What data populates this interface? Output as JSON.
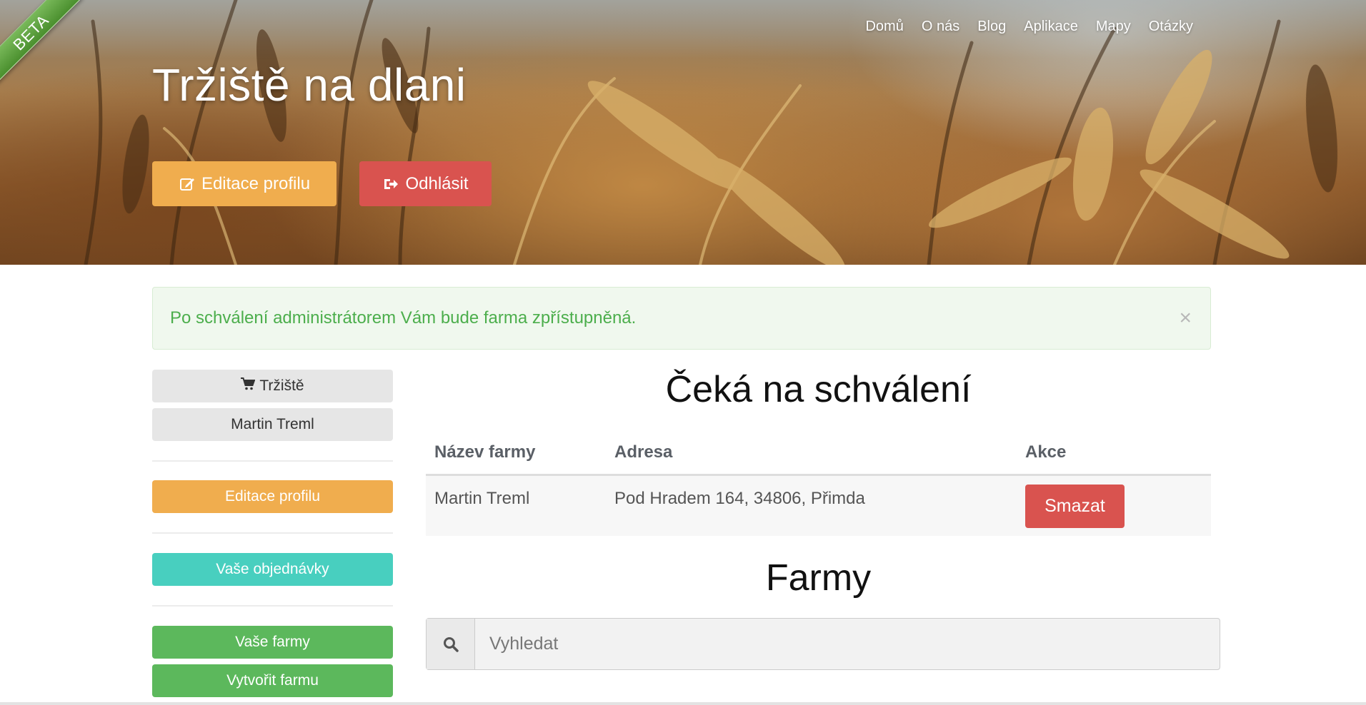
{
  "hero": {
    "beta": "BETA",
    "nav": [
      "Domů",
      "O nás",
      "Blog",
      "Aplikace",
      "Mapy",
      "Otázky"
    ],
    "title": "Tržiště na dlani",
    "edit_profile_label": "Editace profilu",
    "logout_label": "Odhlásit"
  },
  "alert": {
    "message": "Po schválení administrátorem Vám bude farma zpřístupněná.",
    "close": "×"
  },
  "sidebar": {
    "market_label": "Tržiště",
    "user_name": "Martin Treml",
    "edit_profile": "Editace profilu",
    "orders": "Vaše objednávky",
    "farms": "Vaše farmy",
    "create_farm": "Vytvořit farmu"
  },
  "pending": {
    "heading": "Čeká na schválení",
    "columns": [
      "Název farmy",
      "Adresa",
      "Akce"
    ],
    "rows": [
      {
        "name": "Martin Treml",
        "address": "Pod Hradem 164, 34806, Přimda",
        "action": "Smazat"
      }
    ]
  },
  "farms": {
    "heading": "Farmy",
    "search_placeholder": "Vyhledat"
  },
  "colors": {
    "warning": "#f0ad4e",
    "danger": "#d9534f",
    "info": "#48cfbf",
    "success": "#5cb85c",
    "alert_text": "#4cae4c"
  }
}
